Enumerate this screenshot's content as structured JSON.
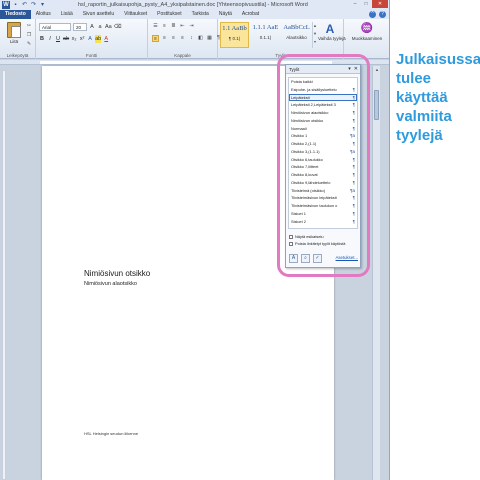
{
  "window": {
    "title": "hsl_raportin_julkaisupohja_pysty_A4_yksipalstainen.doc [Yhteensopivuustila] - Microsoft Word",
    "quick_access": [
      "save-icon",
      "undo-icon",
      "redo-icon",
      "customize-icon"
    ],
    "controls": [
      "minimize-icon",
      "maximize-icon",
      "close-icon"
    ]
  },
  "tabs": [
    "Tiedosto",
    "Aloitus",
    "Lisää",
    "Sivun asettelu",
    "Viittaukset",
    "Postitukset",
    "Tarkista",
    "Näytä",
    "Acrobat"
  ],
  "ribbon": {
    "clipboard": {
      "paste_label": "Liitä",
      "group_label": "Leikepöytä"
    },
    "font": {
      "name": "Arial",
      "size": "20",
      "group_label": "Fontti"
    },
    "paragraph": {
      "group_label": "Kappale"
    },
    "styles": {
      "tiles": [
        {
          "preview": "1.1 AaBb",
          "name": "¶ 0.1)",
          "active": true
        },
        {
          "preview": "1.1.1 AaE",
          "name": "0.1.1)",
          "active": false
        },
        {
          "preview": "AaBbCcL",
          "name": "Alaotsikko",
          "active": false
        }
      ],
      "change_styles_label": "Vaihda tyylejä",
      "group_label": "Tyylit"
    },
    "editing": {
      "label": "Muokkaaminen"
    }
  },
  "document": {
    "title": "Nimiösivun otsikko",
    "subtitle": "Nimiösivun alaotsikko",
    "footer": "HSL Helsingin seudun liikenne"
  },
  "styles_pane": {
    "title": "Tyylit",
    "items": [
      {
        "label": "Poista kaikki",
        "mark": ""
      },
      {
        "label": "Esipuhe- ja sisällysluettelo",
        "mark": "¶"
      },
      {
        "label": "Leipäteksti",
        "mark": "¶",
        "state": "selected"
      },
      {
        "label": "Leipäteksti 2,Leipäteksti 3",
        "mark": "¶"
      },
      {
        "label": "Nimiösivun alaotsikko",
        "mark": "¶"
      },
      {
        "label": "Nimiösivun otsikko",
        "mark": "¶"
      },
      {
        "label": "Normaali",
        "mark": "¶"
      },
      {
        "label": "Otsikko 1",
        "mark": "¶a"
      },
      {
        "label": "Otsikko 2,(1.1)",
        "mark": "¶"
      },
      {
        "label": "Otsikko 3,(1.1.1)",
        "mark": "¶a"
      },
      {
        "label": "Otsikko 6,taulukko",
        "mark": "¶"
      },
      {
        "label": "Otsikko 7,liitteet",
        "mark": "¶"
      },
      {
        "label": "Otsikko 8,kuvat",
        "mark": "¶"
      },
      {
        "label": "Otsikko 9,lähdeluettelo",
        "mark": "¶"
      },
      {
        "label": "Tiivistelmä (otsikko)",
        "mark": "¶a"
      },
      {
        "label": "Tiivistelmäsivun leipäteksti",
        "mark": "¶"
      },
      {
        "label": "Tiivistelmäsivun taulukon o",
        "mark": "¶"
      },
      {
        "label": "Sisluet 1",
        "mark": "¶"
      },
      {
        "label": "Sisluet 2",
        "mark": "¶"
      }
    ],
    "show_preview_label": "Näytä esikatselu",
    "disable_linked_label": "Poista linkitetyt tyylit käytöstä",
    "options_link": "Asetukset..."
  },
  "callout": {
    "lines": [
      "Julkaisussa",
      "tulee",
      "käyttää",
      "valmiita",
      "tyylejä"
    ],
    "color": "#2f9bdc"
  },
  "highlight_color": "#e27ac2"
}
